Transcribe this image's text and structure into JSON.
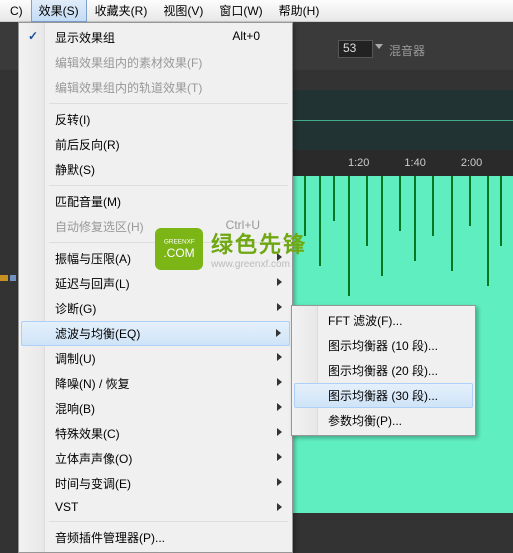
{
  "menubar": {
    "prev_suffix": "C)",
    "items": [
      "效果(S)",
      "收藏夹(R)",
      "视图(V)",
      "窗口(W)",
      "帮助(H)"
    ]
  },
  "toolbar": {
    "input_value": "53",
    "mixer_label": "混音器"
  },
  "timeline": {
    "marks": [
      "1:20",
      "1:40",
      "2:00"
    ]
  },
  "menu": {
    "show_effects_group": "显示效果组",
    "show_effects_group_shortcut": "Alt+0",
    "edit_material_effects": "编辑效果组内的素材效果(F)",
    "edit_track_effects": "编辑效果组内的轨道效果(T)",
    "invert": "反转(I)",
    "front_back_invert": "前后反向(R)",
    "silence": "静默(S)",
    "match_volume": "匹配音量(M)",
    "auto_repair": "自动修复选区(H)",
    "auto_repair_shortcut": "Ctrl+U",
    "amplitude_compress": "振幅与压限(A)",
    "delay_echo": "延迟与回声(L)",
    "diagnose": "诊断(G)",
    "filter_eq": "滤波与均衡(EQ)",
    "modulate": "调制(U)",
    "noise_reduce": "降噪(N) / 恢复",
    "reverb": "混响(B)",
    "special_effects": "特殊效果(C)",
    "stereo": "立体声声像(O)",
    "time_pitch": "时间与变调(E)",
    "vst": "VST",
    "audio_plugin_mgr": "音频插件管理器(P)..."
  },
  "submenu": {
    "fft_filter": "FFT 滤波(F)...",
    "graphic_eq_10": "图示均衡器 (10 段)...",
    "graphic_eq_20": "图示均衡器 (20 段)...",
    "graphic_eq_30": "图示均衡器 (30 段)...",
    "param_eq": "参数均衡(P)..."
  },
  "watermark": {
    "badge_top": "GREENXF",
    "badge_bot": ".COM",
    "text_top": "绿色先锋",
    "text_bot": "www.greenxf.com"
  }
}
